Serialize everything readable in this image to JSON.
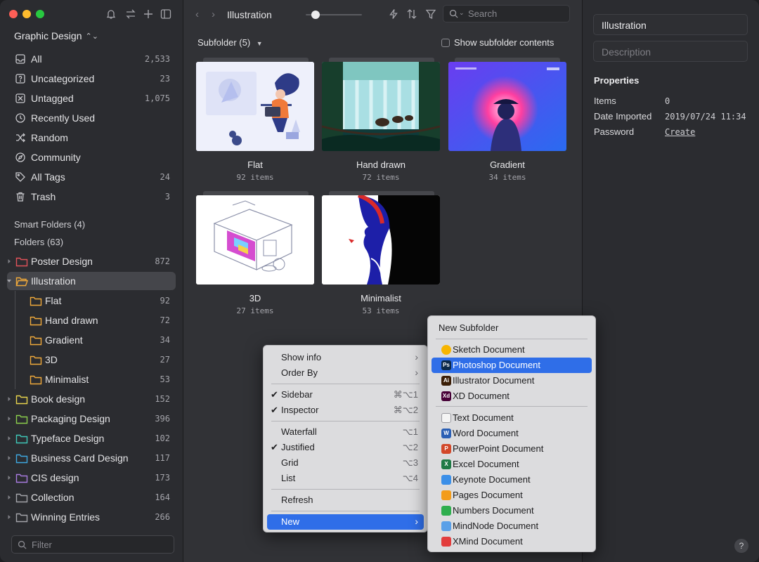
{
  "sidebar": {
    "library_name": "Graphic Design",
    "nav": [
      {
        "label": "All",
        "count": "2,533",
        "icon": "inbox-icon"
      },
      {
        "label": "Uncategorized",
        "count": "23",
        "icon": "question-folder-icon"
      },
      {
        "label": "Untagged",
        "count": "1,075",
        "icon": "tag-off-icon"
      },
      {
        "label": "Recently Used",
        "count": "",
        "icon": "clock-icon"
      },
      {
        "label": "Random",
        "count": "",
        "icon": "shuffle-icon"
      },
      {
        "label": "Community",
        "count": "",
        "icon": "compass-icon"
      },
      {
        "label": "All Tags",
        "count": "24",
        "icon": "tag-icon"
      },
      {
        "label": "Trash",
        "count": "3",
        "icon": "trash-icon"
      }
    ],
    "smart_folders": "Smart Folders (4)",
    "folders_header": "Folders (63)",
    "folders": [
      {
        "label": "Poster Design",
        "count": "872",
        "color": "#e0525a",
        "level": 0,
        "selected": false
      },
      {
        "label": "Illustration",
        "count": "",
        "color": "#f0a93b",
        "level": 0,
        "selected": true
      },
      {
        "label": "Flat",
        "count": "92",
        "color": "#f0a93b",
        "level": 1,
        "selected": false
      },
      {
        "label": "Hand drawn",
        "count": "72",
        "color": "#f0a93b",
        "level": 1,
        "selected": false
      },
      {
        "label": "Gradient",
        "count": "34",
        "color": "#f0a93b",
        "level": 1,
        "selected": false
      },
      {
        "label": "3D",
        "count": "27",
        "color": "#f0a93b",
        "level": 1,
        "selected": false
      },
      {
        "label": "Minimalist",
        "count": "53",
        "color": "#f0a93b",
        "level": 1,
        "selected": false
      },
      {
        "label": "Book design",
        "count": "152",
        "color": "#e8d44d",
        "level": 0,
        "selected": false
      },
      {
        "label": "Packaging Design",
        "count": "396",
        "color": "#8ccf4d",
        "level": 0,
        "selected": false
      },
      {
        "label": "Typeface Design",
        "count": "102",
        "color": "#3fc7b8",
        "level": 0,
        "selected": false
      },
      {
        "label": "Business Card Design",
        "count": "117",
        "color": "#3ea8e0",
        "level": 0,
        "selected": false
      },
      {
        "label": "CIS design",
        "count": "173",
        "color": "#a97be0",
        "level": 0,
        "selected": false
      },
      {
        "label": "Collection",
        "count": "164",
        "color": "#a4a4aa",
        "level": 0,
        "selected": false
      },
      {
        "label": "Winning Entries",
        "count": "266",
        "color": "#a4a4aa",
        "level": 0,
        "selected": false
      }
    ],
    "filter_placeholder": "Filter"
  },
  "toolbar": {
    "title": "Illustration",
    "search_placeholder": "Search",
    "zoom_level": 0.1
  },
  "main": {
    "subfolder_label": "Subfolder (5)",
    "show_subfolder_contents": "Show subfolder contents",
    "items": [
      {
        "name": "Flat",
        "count": "92 items"
      },
      {
        "name": "Hand drawn",
        "count": "72 items"
      },
      {
        "name": "Gradient",
        "count": "34 items"
      },
      {
        "name": "3D",
        "count": "27 items"
      },
      {
        "name": "Minimalist",
        "count": "53 items"
      }
    ]
  },
  "context_menu": {
    "show_info": "Show info",
    "order_by": "Order By",
    "sidebar": "Sidebar",
    "sidebar_sc": "⌘⌥1",
    "inspector": "Inspector",
    "inspector_sc": "⌘⌥2",
    "waterfall": "Waterfall",
    "waterfall_sc": "⌥1",
    "justified": "Justified",
    "justified_sc": "⌥2",
    "grid": "Grid",
    "grid_sc": "⌥3",
    "list": "List",
    "list_sc": "⌥4",
    "refresh": "Refresh",
    "new": "New"
  },
  "submenu": {
    "new_subfolder": "New Subfolder",
    "design_docs": [
      {
        "label": "Sketch Document",
        "badge": "",
        "color": "#f7b500"
      },
      {
        "label": "Photoshop Document",
        "badge": "Ps",
        "color": "#0d2a4a"
      },
      {
        "label": "Illustrator Document",
        "badge": "Ai",
        "color": "#3a1d05"
      },
      {
        "label": "XD Document",
        "badge": "Xd",
        "color": "#470137"
      }
    ],
    "office_docs": [
      {
        "label": "Text Document",
        "badge": "",
        "color": "#f4f4f4"
      },
      {
        "label": "Word Document",
        "badge": "W",
        "color": "#2b5fb4"
      },
      {
        "label": "PowerPoint Document",
        "badge": "P",
        "color": "#d2482a"
      },
      {
        "label": "Excel Document",
        "badge": "X",
        "color": "#1f7a45"
      },
      {
        "label": "Keynote Document",
        "badge": "",
        "color": "#3b8fe8"
      },
      {
        "label": "Pages Document",
        "badge": "",
        "color": "#f39c1a"
      },
      {
        "label": "Numbers Document",
        "badge": "",
        "color": "#2fae4e"
      },
      {
        "label": "MindNode Document",
        "badge": "",
        "color": "#5aa0e8"
      },
      {
        "label": "XMind Document",
        "badge": "",
        "color": "#e23d3d"
      }
    ]
  },
  "inspector": {
    "name_value": "Illustration",
    "description_placeholder": "Description",
    "properties_title": "Properties",
    "items_label": "Items",
    "items_value": "0",
    "date_label": "Date Imported",
    "date_value": "2019/07/24 11:34",
    "password_label": "Password",
    "password_action": "Create",
    "help": "?"
  }
}
